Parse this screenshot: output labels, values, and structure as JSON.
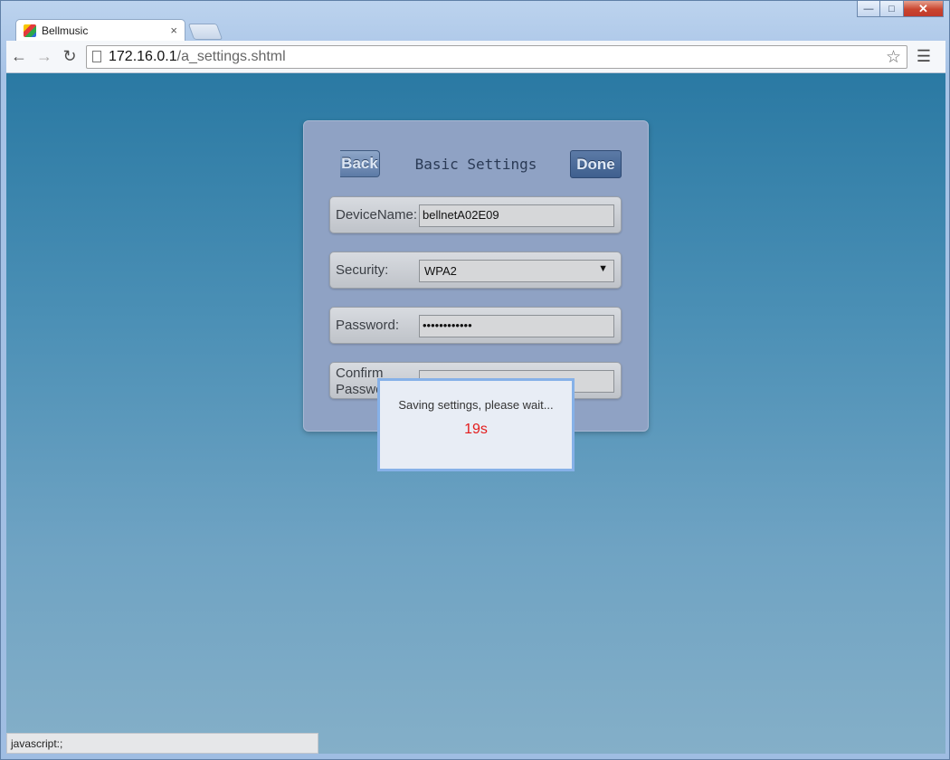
{
  "window": {
    "caption": {
      "minimize": "—",
      "maximize": "□",
      "close": "✕"
    }
  },
  "tabs": [
    {
      "title": "Bellmusic",
      "close": "×"
    }
  ],
  "toolbar": {
    "back": "←",
    "forward": "→",
    "reload": "↻",
    "url_host": "172.16.0.1",
    "url_path": "/a_settings.shtml",
    "star": "☆",
    "menu": "☰"
  },
  "settings": {
    "back_label": "Back",
    "title": "Basic Settings",
    "done_label": "Done",
    "fields": {
      "device_name": {
        "label": "DeviceName:",
        "value": "bellnetA02E09"
      },
      "security": {
        "label": "Security:",
        "value": "WPA2",
        "arrow": "▼"
      },
      "password": {
        "label": "Password:",
        "value": "••••••••••••"
      },
      "confirm_password": {
        "label": "Confirm Password:",
        "value": ""
      }
    }
  },
  "dialog": {
    "message": "Saving settings, please wait...",
    "countdown": "19s",
    "countdown_color": "#e31b1b"
  },
  "statusbar": {
    "text": "javascript:;"
  }
}
